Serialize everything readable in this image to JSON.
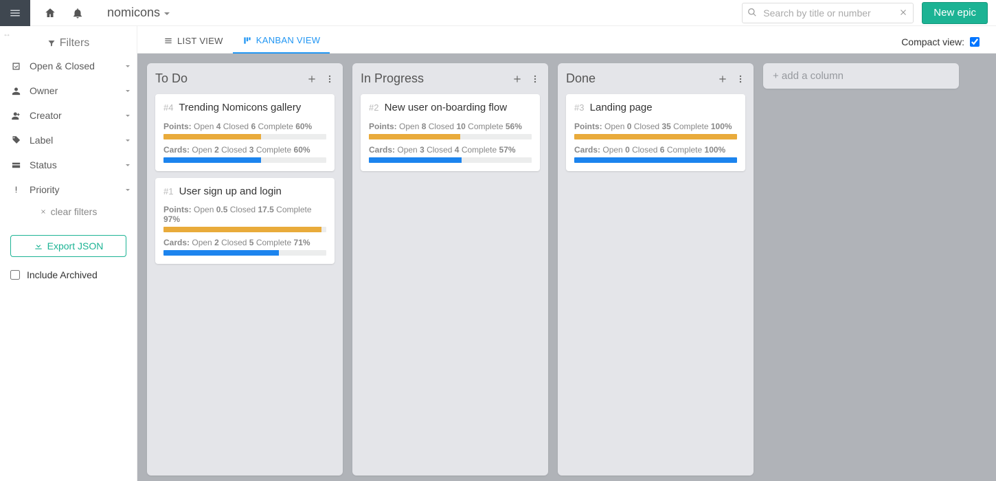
{
  "topbar": {
    "project_name": "nomicons",
    "search_placeholder": "Search by title or number",
    "new_epic_label": "New epic"
  },
  "sidebar": {
    "filters_header": "Filters",
    "items": [
      {
        "label": "Open & Closed"
      },
      {
        "label": "Owner"
      },
      {
        "label": "Creator"
      },
      {
        "label": "Label"
      },
      {
        "label": "Status"
      },
      {
        "label": "Priority"
      }
    ],
    "clear_filters": "clear filters",
    "export_label": "Export JSON",
    "include_archived_label": "Include Archived"
  },
  "viewbar": {
    "list_view_label": "LIST VIEW",
    "kanban_view_label": "KANBAN VIEW",
    "compact_label": "Compact view:"
  },
  "board": {
    "columns": [
      {
        "title": "To Do",
        "cards": [
          {
            "num": "#4",
            "title": "Trending Nomicons gallery",
            "points": {
              "label": "Points:",
              "open_lbl": "Open",
              "open": "4",
              "closed_lbl": "Closed",
              "closed": "6",
              "complete_lbl": "Complete",
              "complete": "60%",
              "pct": 60
            },
            "cards": {
              "label": "Cards:",
              "open_lbl": "Open",
              "open": "2",
              "closed_lbl": "Closed",
              "closed": "3",
              "complete_lbl": "Complete",
              "complete": "60%",
              "pct": 60
            }
          },
          {
            "num": "#1",
            "title": "User sign up and login",
            "points": {
              "label": "Points:",
              "open_lbl": "Open",
              "open": "0.5",
              "closed_lbl": "Closed",
              "closed": "17.5",
              "complete_lbl": "Complete",
              "complete": "97%",
              "pct": 97
            },
            "cards": {
              "label": "Cards:",
              "open_lbl": "Open",
              "open": "2",
              "closed_lbl": "Closed",
              "closed": "5",
              "complete_lbl": "Complete",
              "complete": "71%",
              "pct": 71
            }
          }
        ]
      },
      {
        "title": "In Progress",
        "cards": [
          {
            "num": "#2",
            "title": "New user on-boarding flow",
            "points": {
              "label": "Points:",
              "open_lbl": "Open",
              "open": "8",
              "closed_lbl": "Closed",
              "closed": "10",
              "complete_lbl": "Complete",
              "complete": "56%",
              "pct": 56
            },
            "cards": {
              "label": "Cards:",
              "open_lbl": "Open",
              "open": "3",
              "closed_lbl": "Closed",
              "closed": "4",
              "complete_lbl": "Complete",
              "complete": "57%",
              "pct": 57
            }
          }
        ]
      },
      {
        "title": "Done",
        "cards": [
          {
            "num": "#3",
            "title": "Landing page",
            "points": {
              "label": "Points:",
              "open_lbl": "Open",
              "open": "0",
              "closed_lbl": "Closed",
              "closed": "35",
              "complete_lbl": "Complete",
              "complete": "100%",
              "pct": 100
            },
            "cards": {
              "label": "Cards:",
              "open_lbl": "Open",
              "open": "0",
              "closed_lbl": "Closed",
              "closed": "6",
              "complete_lbl": "Complete",
              "complete": "100%",
              "pct": 100
            }
          }
        ]
      }
    ],
    "add_column_label": "+ add a column"
  }
}
